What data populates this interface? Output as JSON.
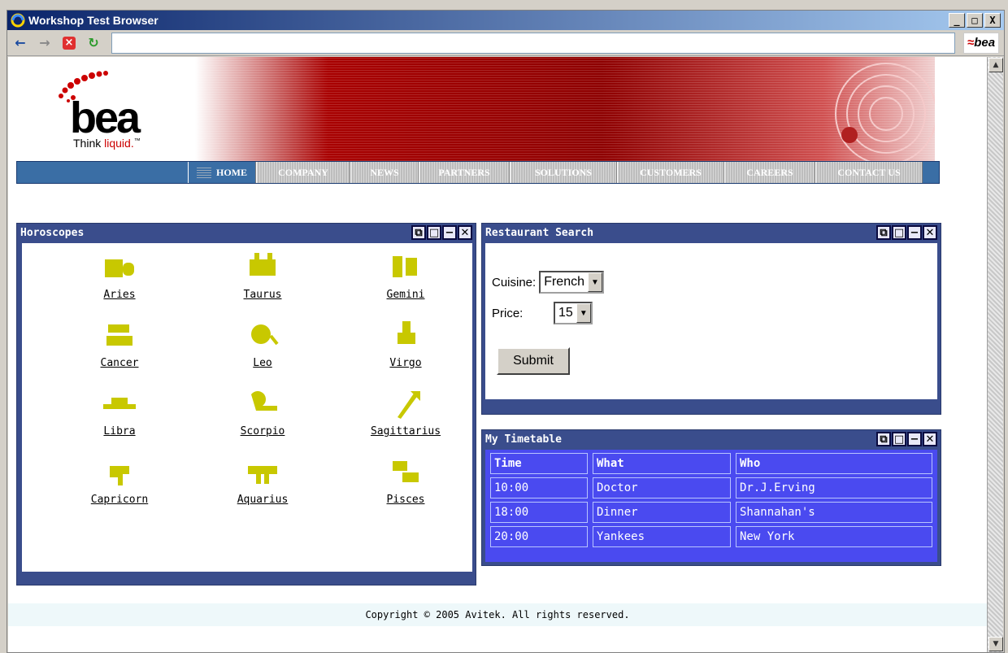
{
  "window": {
    "title": "Workshop Test Browser",
    "controls": [
      "_",
      "□",
      "X"
    ]
  },
  "toolbar": {
    "back": "←",
    "forward": "→",
    "stop": "×",
    "refresh": "↻",
    "address": "",
    "brand": "bea"
  },
  "logo": {
    "word": "bea",
    "tagline_a": "Think ",
    "tagline_b": "liquid.",
    "tm": "™"
  },
  "nav": [
    {
      "label": "HOME",
      "active": true
    },
    {
      "label": "COMPANY"
    },
    {
      "label": "NEWS"
    },
    {
      "label": "PARTNERS"
    },
    {
      "label": "SOLUTIONS"
    },
    {
      "label": "CUSTOMERS"
    },
    {
      "label": "CAREERS"
    },
    {
      "label": "CONTACT US"
    }
  ],
  "horoscopes": {
    "title": "Horoscopes",
    "signs": [
      "Aries",
      "Taurus",
      "Gemini",
      "Cancer",
      "Leo",
      "Virgo",
      "Libra",
      "Scorpio",
      "Sagittarius",
      "Capricorn",
      "Aquarius",
      "Pisces"
    ],
    "icon_color": "#c8c800"
  },
  "restaurant": {
    "title": "Restaurant Search",
    "cuisine_label": "Cuisine:",
    "cuisine_value": "French",
    "price_label": "Price:",
    "price_value": "15",
    "submit_label": "Submit"
  },
  "timetable": {
    "title": "My Timetable",
    "headers": [
      "Time",
      "What",
      "Who"
    ],
    "rows": [
      [
        "10:00",
        "Doctor",
        "Dr.J.Erving"
      ],
      [
        "18:00",
        "Dinner",
        "Shannahan's"
      ],
      [
        "20:00",
        "Yankees",
        "New York"
      ]
    ]
  },
  "footer": {
    "text": "Copyright © 2005 Avitek. All rights reserved."
  },
  "colors": {
    "portlet": "#3a4d8c",
    "timetable_bg": "#4a4af0",
    "banner": "#a80000",
    "nav": "#3a6ea5"
  }
}
